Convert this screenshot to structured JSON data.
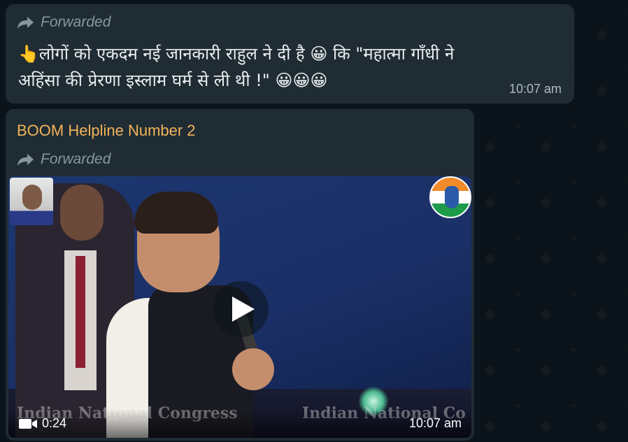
{
  "messages": [
    {
      "forwarded_label": "Forwarded",
      "text_line1": "👆लोगों को एकदम नई जानकारी राहुल ने दी है 😀 कि \"महात्मा गाँधी ने",
      "text_line2": "अहिंसा की प्रेरणा इस्लाम घर्म से ली थी !\" 😀😀😀",
      "time": "10:07 am"
    },
    {
      "sender": "BOOM Helpline Number 2",
      "forwarded_label": "Forwarded",
      "video": {
        "duration": "0:24",
        "time": "10:07 am",
        "watermark_left": "Indian National Congress",
        "watermark_right": "Indian National Co"
      }
    }
  ],
  "colors": {
    "chat_bg": "#0b141a",
    "bubble_bg": "#202c33",
    "sender_name": "#f0b45a",
    "meta_text": "#8696a0"
  },
  "icons": [
    "forward-arrow-icon",
    "play-icon",
    "video-camera-icon"
  ]
}
